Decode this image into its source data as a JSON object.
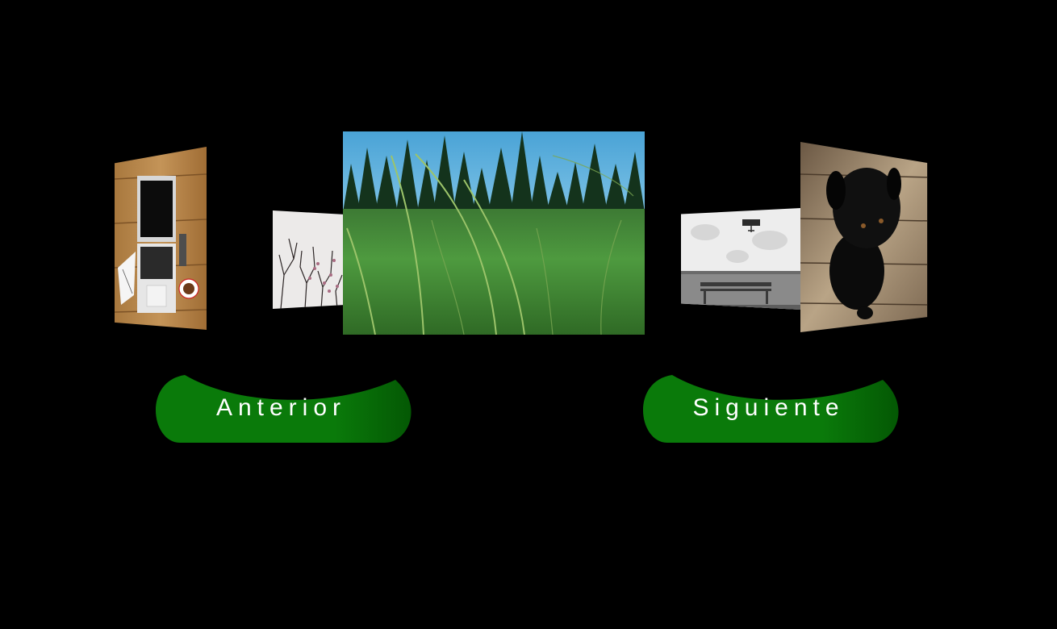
{
  "gallery": {
    "slides": [
      {
        "id": "laptop",
        "icon": "laptop-desk-photo"
      },
      {
        "id": "branches",
        "icon": "tree-branches-photo"
      },
      {
        "id": "grass",
        "icon": "grass-field-photo"
      },
      {
        "id": "bench",
        "icon": "bench-wall-photo"
      },
      {
        "id": "dog",
        "icon": "black-dog-photo"
      }
    ],
    "active_slide": "grass"
  },
  "controls": {
    "prev_label": "Anterior",
    "next_label": "Siguiente",
    "button_color": "#0a7a0a",
    "button_shadow": "#045804",
    "label_color": "#ffffff"
  },
  "theme": {
    "background": "#000000"
  }
}
